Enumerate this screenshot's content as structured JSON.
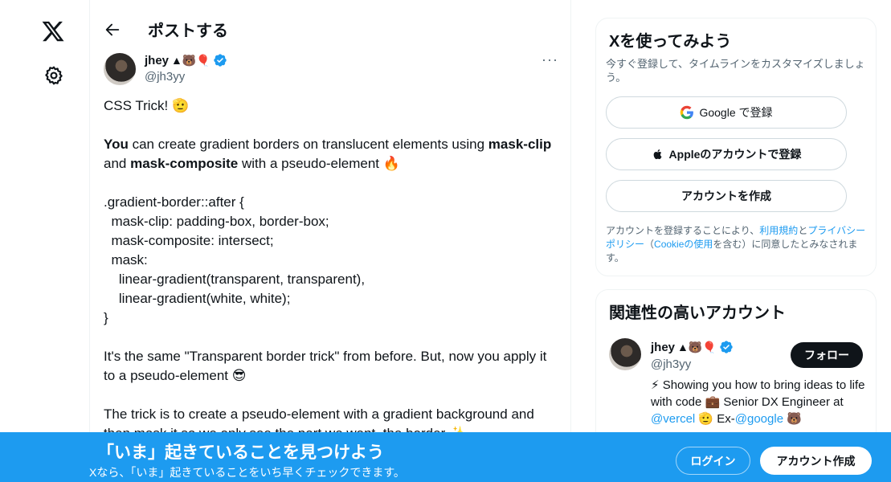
{
  "nav": {
    "logo": "x-logo",
    "settings": "gear-icon"
  },
  "header": {
    "title": "ポストする"
  },
  "post": {
    "author": {
      "name": "jhey",
      "emojis": "▲🐻🎈",
      "handle": "@jh3yy"
    },
    "more": "···",
    "paragraphs": [
      {
        "parts": [
          {
            "t": "CSS Trick! 🫡"
          }
        ]
      },
      {
        "parts": [
          {
            "t": "You",
            "b": true
          },
          {
            "t": " can create gradient borders on translucent elements using "
          },
          {
            "t": "mask-clip",
            "b": true
          },
          {
            "t": " and "
          },
          {
            "t": "mask-composite",
            "b": true
          },
          {
            "t": " with a pseudo-element 🔥"
          }
        ]
      }
    ],
    "code": [
      ".gradient-border::after {",
      "  mask-clip: padding-box, border-box;",
      "  mask-composite: intersect;",
      "  mask:",
      "    linear-gradient(transparent, transparent),",
      "    linear-gradient(white, white);",
      "}"
    ],
    "para3": "It's the same \"Transparent border trick\" from before. But, now you apply it to a pseudo-element 😎",
    "para4": "The trick is to create a pseudo-element with a gradient background and then mask it so we only see the part we want, the border ✨"
  },
  "signup": {
    "title": "Xを使ってみよう",
    "subtitle": "今すぐ登録して、タイムラインをカスタマイズしましょう。",
    "google_label": "Google で登録",
    "apple_label": "Appleのアカウントで登録",
    "create_label": "アカウントを作成",
    "terms_pre": "アカウントを登録することにより、",
    "terms_link1": "利用規約",
    "terms_mid": "と",
    "terms_link2": "プライバシーポリシー",
    "terms_mid2": "（",
    "terms_link3": "Cookieの使用",
    "terms_post": "を含む）に同意したとみなされます。"
  },
  "related": {
    "title": "関連性の高いアカウント",
    "name": "jhey",
    "emojis": "▲🐻🎈",
    "handle": "@jh3yy",
    "follow_label": "フォロー",
    "bio_1": "⚡ Showing you how to bring ideas to life with code 💼 Senior DX Engineer at ",
    "bio_link1": "@vercel",
    "bio_2": " 🫡 Ex-",
    "bio_link2": "@google",
    "bio_3": " 🐻"
  },
  "banner": {
    "title": "「いま」起きていることを見つけよう",
    "subtitle": "Xなら、「いま」起きていることをいち早くチェックできます。",
    "login_label": "ログイン",
    "create_label": "アカウント作成"
  },
  "colors": {
    "accent": "#1d9bf0",
    "text": "#0f1419",
    "muted": "#536471"
  }
}
